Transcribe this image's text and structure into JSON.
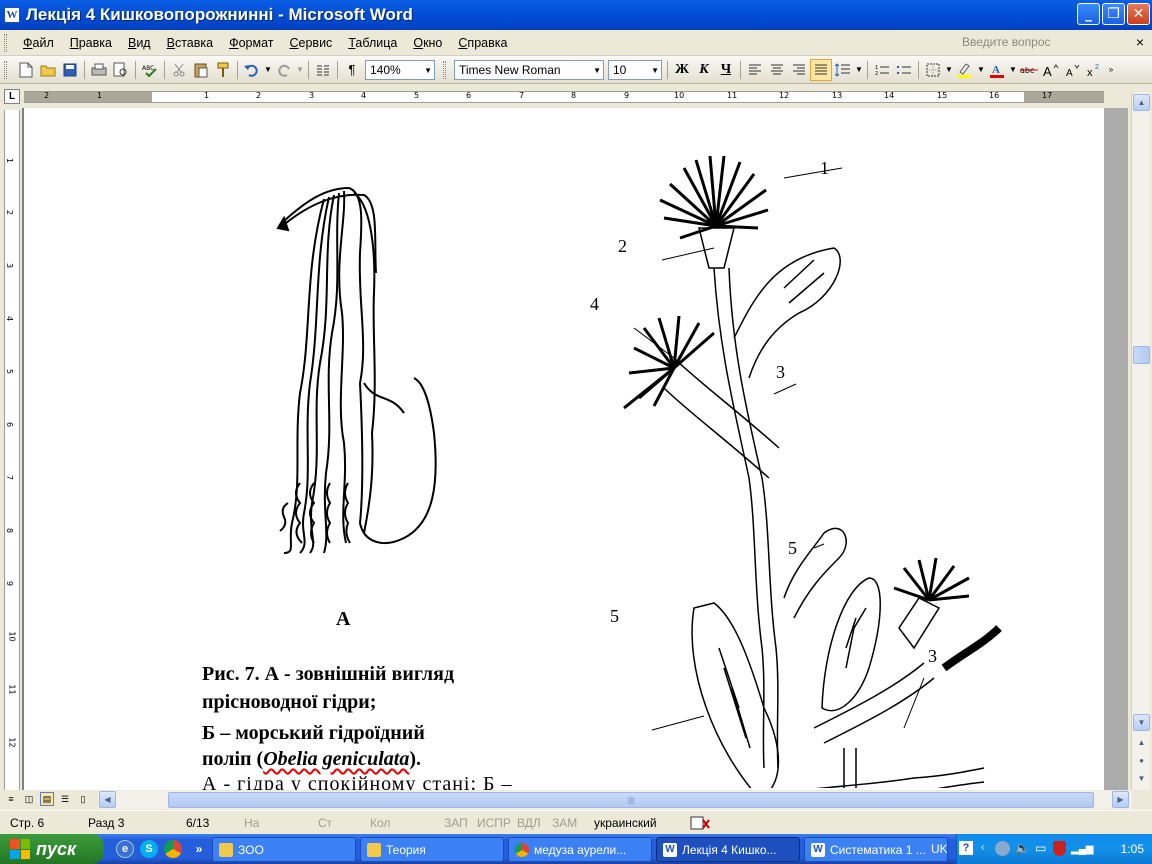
{
  "window": {
    "title": "Лекція 4 Кишковопорожнинні - Microsoft Word",
    "app_icon": "W",
    "controls": {
      "minimize": "_",
      "restore": "❐",
      "close": "✕"
    }
  },
  "menubar": {
    "items": [
      "Файл",
      "Правка",
      "Вид",
      "Вставка",
      "Формат",
      "Сервис",
      "Таблица",
      "Окно",
      "Справка"
    ],
    "question_placeholder": "Введите вопрос",
    "close_glyph": "×"
  },
  "toolbar": {
    "zoom": "140%",
    "font": "Times New Roman",
    "font_size": "10",
    "bold": "Ж",
    "italic": "К",
    "underline": "Ч",
    "pilcrow": "¶"
  },
  "ruler": {
    "numbers": [
      "2",
      "1",
      "1",
      "2",
      "3",
      "4",
      "5",
      "6",
      "7",
      "8",
      "9",
      "10",
      "11",
      "12",
      "13",
      "14",
      "15",
      "16",
      "17"
    ],
    "tab_marker": "L"
  },
  "vruler": {
    "numbers": [
      "1",
      "1",
      "2",
      "3",
      "4",
      "5",
      "6",
      "7",
      "8",
      "9",
      "10",
      "11",
      "12"
    ]
  },
  "document": {
    "figure_letter": "А",
    "caption_line1": "Рис. 7. А - зовнішній вигляд",
    "caption_line2": "прісноводної гідри;",
    "caption_line3": "Б –  морський  гідроїдний",
    "caption_line4_pre": "поліп  (",
    "caption_line4_latin": "Obelia geniculata",
    "caption_line4_post": ").",
    "caption_line5": "А  -  гідра  у  спокійному  стані;  Б  –",
    "labels": [
      "1",
      "2",
      "3",
      "4",
      "5",
      "5",
      "3"
    ]
  },
  "statusbar": {
    "page": "Стр. 6",
    "section": "Разд 3",
    "pages": "6/13",
    "at": "На",
    "line": "Ст",
    "col": "Кол",
    "rec": "ЗАП",
    "trk": "ИСПР",
    "ext": "ВДЛ",
    "ovr": "ЗАМ",
    "language": "украинский"
  },
  "taskbar": {
    "start_label": "пуск",
    "tasks": [
      {
        "label": "ЗОО",
        "icon": "folder-icon"
      },
      {
        "label": "Теория",
        "icon": "folder-icon"
      },
      {
        "label": "медуза аурели...",
        "icon": "chrome-icon"
      },
      {
        "label": "Лекція 4 Кишко...",
        "icon": "word-icon"
      },
      {
        "label": "Систематика 1 ...",
        "icon": "word-icon"
      }
    ],
    "lang": "UK",
    "clock": "1:05"
  },
  "colors": {
    "titlebar": "#0350D8",
    "taskbar": "#245EDB",
    "start": "#2E8B2E",
    "chrome_bg": "#ECE9D8"
  }
}
